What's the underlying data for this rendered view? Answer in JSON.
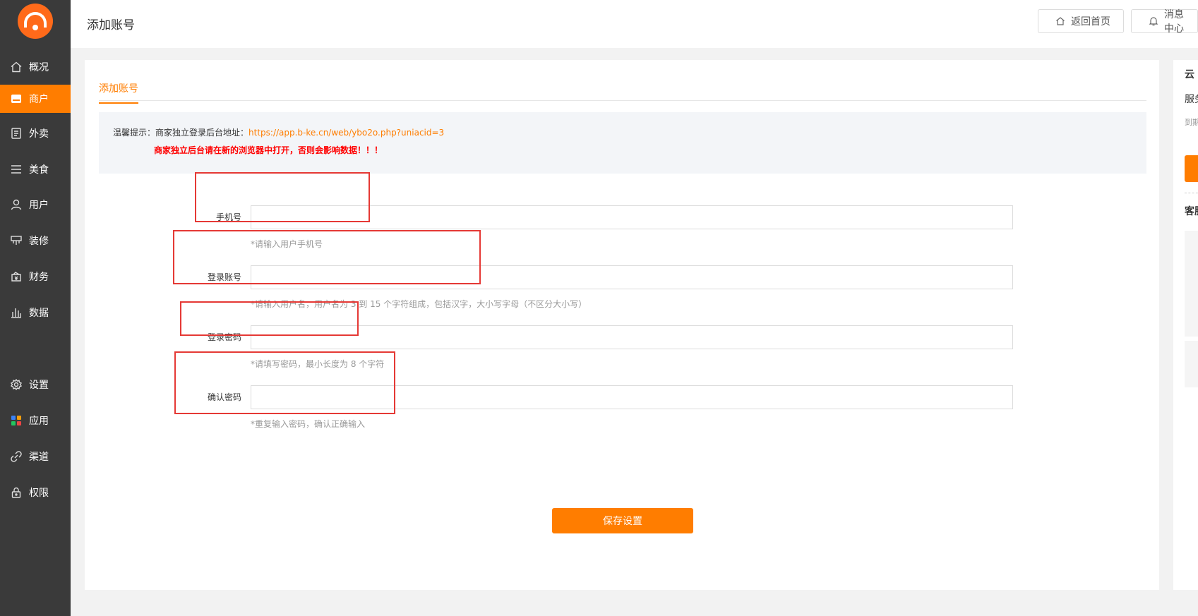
{
  "app": {
    "page_title": "添加账号"
  },
  "sidebar": {
    "items": [
      {
        "label": "概况",
        "icon": "home-icon",
        "active": false
      },
      {
        "label": "商户",
        "icon": "shop-icon",
        "active": true
      },
      {
        "label": "外卖",
        "icon": "document-icon",
        "active": false
      },
      {
        "label": "美食",
        "icon": "menu-icon",
        "active": false
      },
      {
        "label": "用户",
        "icon": "user-icon",
        "active": false
      },
      {
        "label": "装修",
        "icon": "decorate-icon",
        "active": false
      },
      {
        "label": "财务",
        "icon": "finance-icon",
        "active": false
      },
      {
        "label": "数据",
        "icon": "chart-icon",
        "active": false
      },
      {
        "label": "设置",
        "icon": "gear-icon",
        "active": false
      },
      {
        "label": "应用",
        "icon": "apps-icon",
        "active": false
      },
      {
        "label": "渠道",
        "icon": "link-icon",
        "active": false
      },
      {
        "label": "权限",
        "icon": "lock-icon",
        "active": false
      }
    ]
  },
  "header": {
    "home_button": "返回首页",
    "message_button": "消息中心"
  },
  "tabs": [
    {
      "label": "添加账号",
      "active": true
    }
  ],
  "notice": {
    "prefix": "温馨提示：商家独立登录后台地址：",
    "url": "https://app.b-ke.cn/web/ybo2o.php?uniacid=3",
    "warning": "商家独立后台请在新的浏览器中打开，否则会影响数据！！！"
  },
  "form": {
    "fields": [
      {
        "label": "手机号",
        "value": "",
        "hint": "*请输入用户手机号"
      },
      {
        "label": "登录账号",
        "value": "",
        "hint": "*请输入用户名，用户名为 3 到 15 个字符组成，包括汉字，大小写字母（不区分大小写）"
      },
      {
        "label": "登录密码",
        "value": "",
        "hint": "*请填写密码，最小长度为 8 个字符"
      },
      {
        "label": "确认密码",
        "value": "",
        "hint": "*重复输入密码，确认正确输入"
      }
    ],
    "save_label": "保存设置"
  },
  "right_panel": {
    "title": "云",
    "line2": "服务",
    "small": "到期",
    "section": "客服"
  },
  "colors": {
    "accent": "#ff7d00",
    "sidebar_bg": "#3a3a3a",
    "warning": "#ff0000",
    "highlight_box": "#e53935"
  }
}
